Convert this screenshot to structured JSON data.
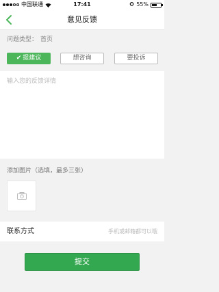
{
  "status_bar": {
    "carrier": "中国联通",
    "time": "17:41",
    "battery_text": "55%",
    "battery_level": 0.55,
    "signal_icon": "signal-dots-icon",
    "wifi_icon": "wifi-icon",
    "alarm_icon": "alarm-clock-icon",
    "battery_icon": "battery-icon"
  },
  "nav": {
    "title": "意见反馈",
    "back_icon": "chevron-left-icon"
  },
  "issue": {
    "label": "问题类型：",
    "value": "首页"
  },
  "tabs": [
    {
      "label": "提建议",
      "active": true
    },
    {
      "label": "想咨询",
      "active": false
    },
    {
      "label": "要投诉",
      "active": false
    }
  ],
  "detail": {
    "placeholder": "输入您的反馈详情",
    "value": ""
  },
  "images": {
    "label": "添加图片（选填，最多三张）",
    "add_icon": "camera-icon"
  },
  "contact": {
    "label": "联系方式",
    "placeholder": "手机或邮箱都可以哦",
    "value": ""
  },
  "submit": {
    "label": "提交"
  },
  "colors": {
    "accent": "#4cb65a",
    "submit": "#34a850"
  }
}
